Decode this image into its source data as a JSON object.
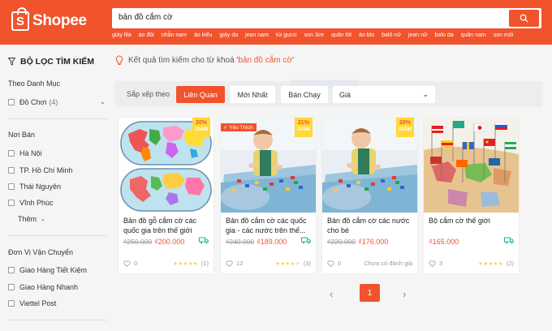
{
  "header": {
    "logo_letter": "S",
    "logo_text": "Shopee",
    "search_value": "bản đồ cắm cờ",
    "keywords": [
      "giày fila",
      "áo đôi",
      "nhẫn nam",
      "áo kiểu",
      "giày da",
      "jean nam",
      "túi gucci",
      "son 3ce",
      "quần lót",
      "áo bts",
      "balô nữ",
      "jean nữ",
      "balo da",
      "quần nam",
      "son môi"
    ]
  },
  "sidebar": {
    "filter_title": "BỘ LỌC TÌM KIẾM",
    "category_title": "Theo Danh Mục",
    "category_option": "Đồ Chơi",
    "category_count": "(4)",
    "location_title": "Nơi Bán",
    "locations": [
      "Hà Nội",
      "TP. Hồ Chí Minh",
      "Thái Nguyên",
      "Vĩnh Phúc"
    ],
    "more_label": "Thêm",
    "shipping_title": "Đơn Vị Vận Chuyển",
    "shipping": [
      "Giao Hàng Tiết Kiệm",
      "Giao Hàng Nhanh",
      "Viettel Post"
    ]
  },
  "results": {
    "prefix": "Kết quả tìm kiếm cho từ khoá '",
    "keyword": "bản đồ cắm cờ",
    "suffix": "'"
  },
  "sort": {
    "label": "Sắp xếp theo",
    "options": [
      "Liên Quan",
      "Mới Nhất",
      "Bán Chạy"
    ],
    "price_select": "Giá"
  },
  "products": [
    {
      "title": "Bản đồ gỗ cắm cờ các quốc gia trên thế giới",
      "old_price": "₫250.000",
      "price": "₫200.000",
      "likes": "0",
      "rating_count": "(1)",
      "discount": "20%",
      "discount_label": "GIẢM",
      "badge": "",
      "no_rating": ""
    },
    {
      "title": "Bản đồ cắm cờ các quốc gia - các nước trên thế...",
      "old_price": "₫240.000",
      "price": "₫189.000",
      "likes": "12",
      "rating_count": "(3)",
      "discount": "21%",
      "discount_label": "GIẢM",
      "badge": "✓ Yêu Thích",
      "no_rating": ""
    },
    {
      "title": "Bản đồ cắm cờ các nước cho bé",
      "old_price": "₫220.000",
      "price": "₫176.000",
      "likes": "0",
      "rating_count": "",
      "discount": "20%",
      "discount_label": "GIẢM",
      "badge": "",
      "no_rating": "Chưa có đánh giá"
    },
    {
      "title": "Bộ cắm cờ thế giới",
      "old_price": "",
      "price": "₫165.000",
      "likes": "3",
      "rating_count": "(2)",
      "discount": "",
      "discount_label": "",
      "badge": "",
      "no_rating": ""
    }
  ],
  "pagination": {
    "current": "1",
    "prev": "‹",
    "next": "›"
  },
  "colors": {
    "brand": "#f1532d",
    "star": "#ffce3d",
    "discount_bg": "#ffd839"
  }
}
